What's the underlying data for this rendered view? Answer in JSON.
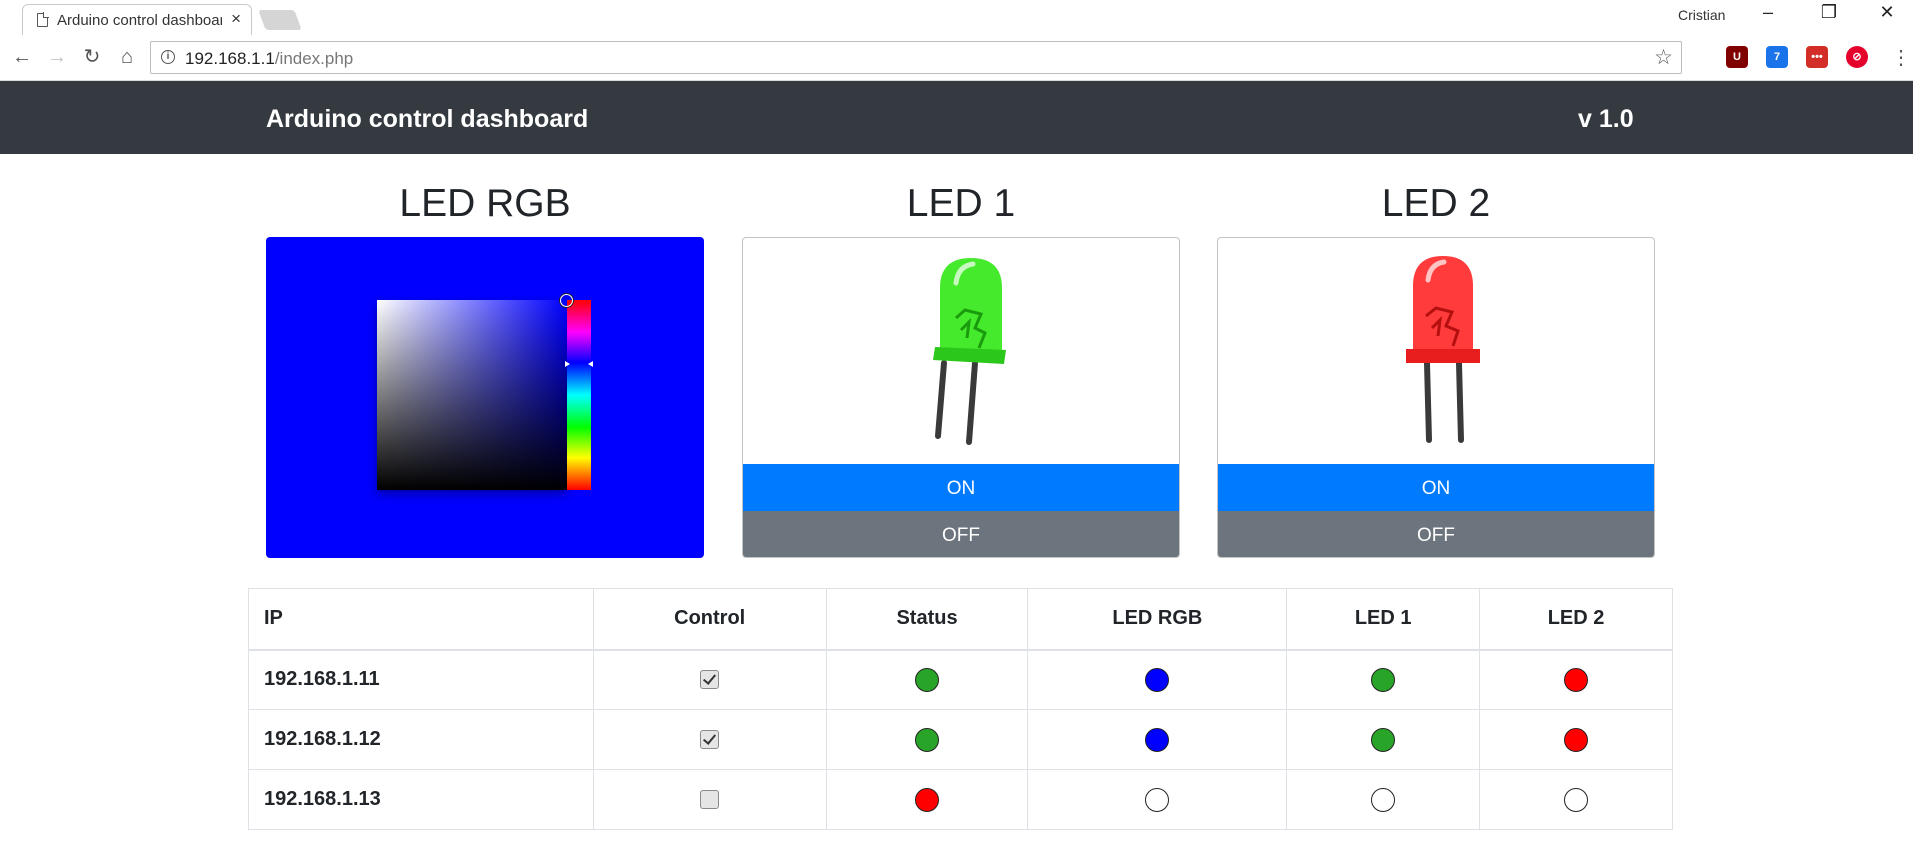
{
  "browser": {
    "tab_title": "Arduino control dashboard",
    "tab_close": "×",
    "profile_name": "Cristian",
    "window_controls": [
      "–",
      "❐",
      "✕"
    ],
    "url_host": "192.168.1.1",
    "url_path": "/index.php",
    "extensions": [
      {
        "name": "ublock-origin-icon",
        "label": "U",
        "color": "#800000"
      },
      {
        "name": "mail-notifier-icon",
        "label": "7",
        "color": "#1a73e8"
      },
      {
        "name": "lastpass-icon",
        "label": "•••",
        "color": "#d32d27"
      },
      {
        "name": "adblock-icon",
        "label": "⊘",
        "color": "#e4002b"
      }
    ]
  },
  "navbar": {
    "brand": "Arduino control dashboard",
    "version": "v 1.0"
  },
  "cards": {
    "rgb": {
      "title": "LED RGB",
      "color": "#0000ff"
    },
    "led1": {
      "title": "LED 1",
      "led_color": "#33ee11",
      "on_label": "ON",
      "off_label": "OFF"
    },
    "led2": {
      "title": "LED 2",
      "led_color": "#ff2222",
      "on_label": "ON",
      "off_label": "OFF"
    }
  },
  "table": {
    "headers": [
      "IP",
      "Control",
      "Status",
      "LED RGB",
      "LED 1",
      "LED 2"
    ],
    "rows": [
      {
        "ip": "192.168.1.11",
        "control": true,
        "status": "#28a428",
        "led_rgb": "#0000ff",
        "led1": "#28a428",
        "led2": "#ff0000"
      },
      {
        "ip": "192.168.1.12",
        "control": true,
        "status": "#28a428",
        "led_rgb": "#0000ff",
        "led1": "#28a428",
        "led2": "#ff0000"
      },
      {
        "ip": "192.168.1.13",
        "control": false,
        "status": "#ff0000",
        "led_rgb": "#ffffff",
        "led1": "#ffffff",
        "led2": "#ffffff"
      }
    ]
  },
  "colors": {
    "navbar_bg": "#343a40",
    "primary": "#007bff",
    "secondary": "#6c757d"
  }
}
